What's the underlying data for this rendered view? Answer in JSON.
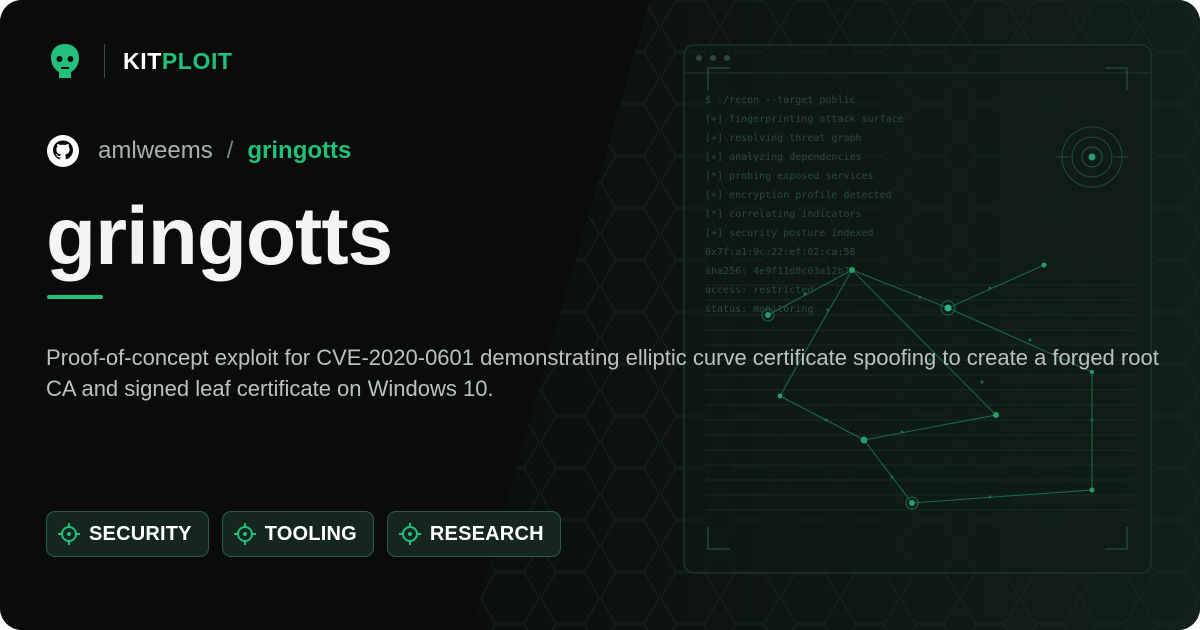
{
  "brand": {
    "part1": "KIT",
    "part2": "PLOIT"
  },
  "repo": {
    "owner": "amlweems",
    "separator": "/",
    "name": "gringotts"
  },
  "title": "gringotts",
  "description": "Proof-of-concept exploit for CVE-2020-0601 demonstrating elliptic curve certificate spoofing to create a forged root CA and signed leaf certificate on Windows 10.",
  "tags": [
    "SECURITY",
    "TOOLING",
    "RESEARCH"
  ],
  "terminal": {
    "lines": [
      "$ ./recon --target public",
      "[+] fingerprinting attack surface",
      "[+] resolving threat graph",
      "[+] analyzing dependencies",
      "[*] probing exposed services",
      "[+] encryption profile detected",
      "[*] correlating indicators",
      "[+] security posture indexed",
      "0x7f:a1:9c:22:ef:02:ca:58",
      "sha256: 4e9f11d8c03a12b7",
      "access: restricted",
      "status: monitoring"
    ]
  },
  "icons": [
    "kitploit-logo-icon",
    "github-icon",
    "crosshair-icon"
  ],
  "colors": {
    "accent": "#22c07a",
    "background": "#0d1512",
    "text": "#f3f5f4",
    "muted": "#b9c2be"
  }
}
